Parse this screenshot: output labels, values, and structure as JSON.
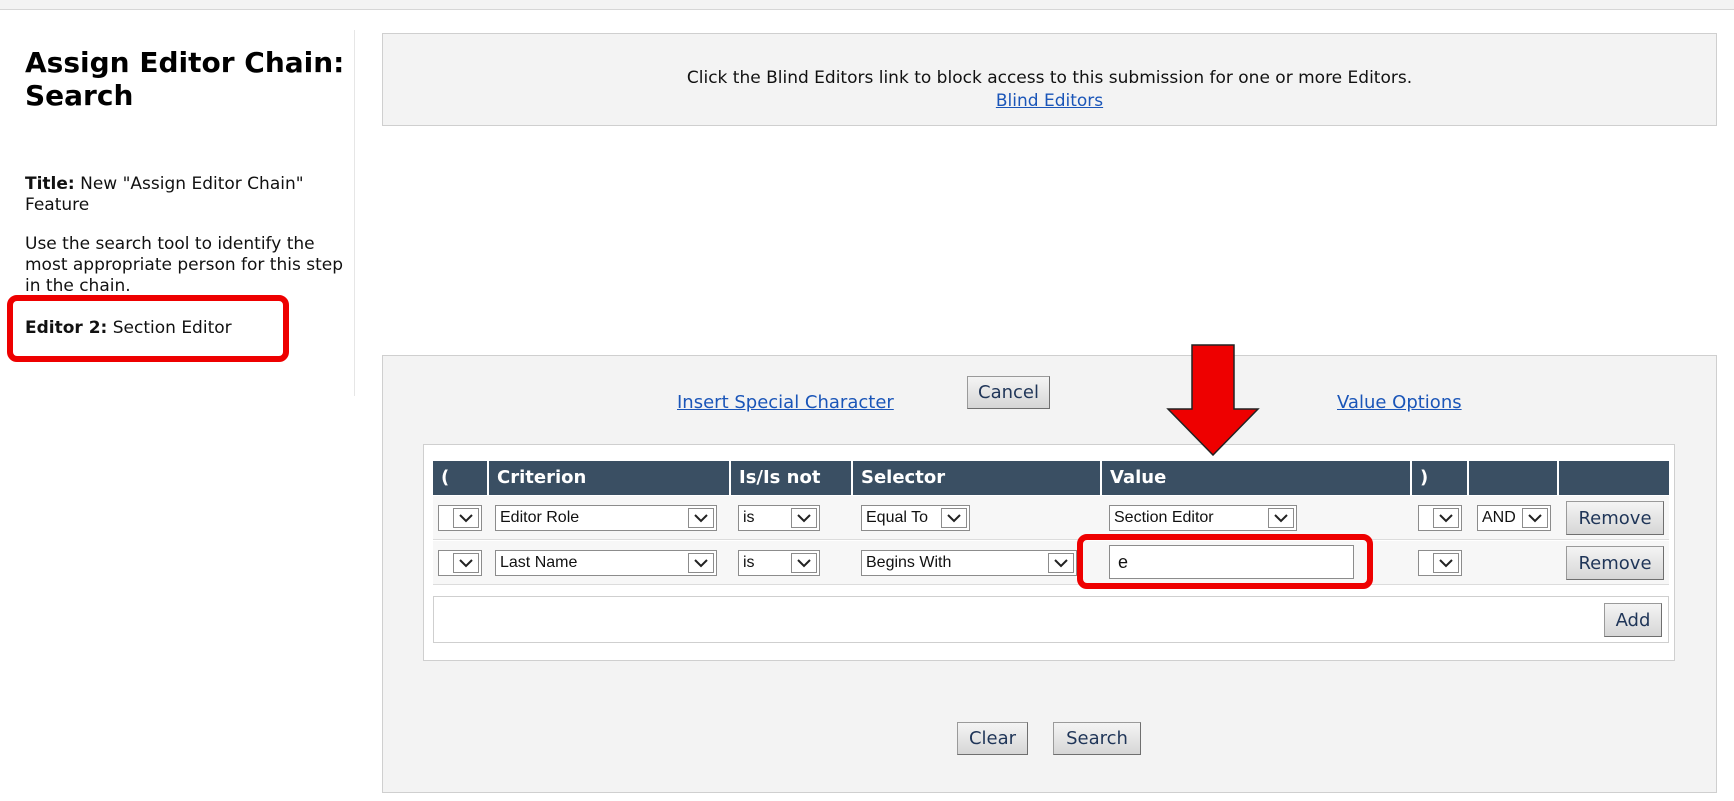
{
  "sidebar": {
    "title": "Assign Editor Chain: Search",
    "title_label": "Title:",
    "title_value": "New \"Assign Editor Chain\" Feature",
    "description": "Use the search tool to identify the most appropriate person for this step in the chain.",
    "editor_label": "Editor 2:",
    "editor_value": "Section Editor"
  },
  "blind": {
    "message": "Click the Blind Editors link to block access to this submission for one or more Editors.",
    "link": "Blind Editors"
  },
  "search": {
    "insert_special_character": "Insert Special Character",
    "cancel": "Cancel",
    "value_options": "Value Options",
    "headers": [
      "(",
      "Criterion",
      "Is/Is not",
      "Selector",
      "Value",
      ")",
      ""
    ],
    "rows": [
      {
        "open_paren": "",
        "criterion": "Editor Role",
        "is_not": "is",
        "selector": "Equal To",
        "value": "Section Editor",
        "close_paren": "",
        "conjunction": "AND",
        "remove": "Remove"
      },
      {
        "open_paren": "",
        "criterion": "Last Name",
        "is_not": "is",
        "selector": "Begins With",
        "value": "e",
        "close_paren": "",
        "remove": "Remove"
      }
    ],
    "add": "Add",
    "clear": "Clear",
    "search": "Search"
  },
  "colors": {
    "header_bg": "#3a4f63",
    "link": "#1a55b8",
    "highlight": "#ee0000",
    "panel_bg": "#f3f3f3"
  }
}
